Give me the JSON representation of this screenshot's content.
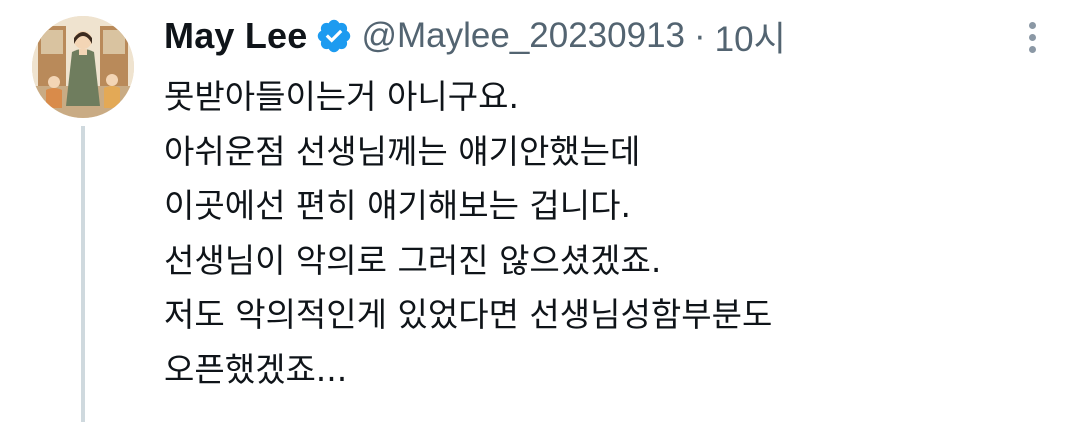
{
  "tweet": {
    "display_name": "May Lee",
    "handle": "@Maylee_20230913",
    "separator": "·",
    "time": "10시",
    "verified": true,
    "lines": [
      "못받아들이는거 아니구요.",
      "아쉬운점 선생님께는 얘기안했는데",
      "이곳에선 편히 얘기해보는 겁니다.",
      "선생님이 악의로 그러진 않으셨겠죠.",
      "저도 악의적인게 있었다면 선생님성함부분도",
      "오픈했겠죠..."
    ]
  },
  "colors": {
    "verified_badge": "#1d9bf0",
    "secondary_text": "#536471",
    "thread_line": "#cfd9de"
  },
  "icons": {
    "verified": "verified-badge-icon",
    "more": "more-vertical-icon"
  }
}
